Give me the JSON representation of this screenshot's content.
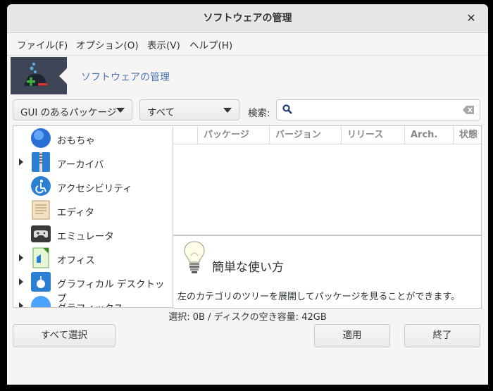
{
  "window": {
    "title": "ソフトウェアの管理",
    "close_glyph": "✕"
  },
  "menu": [
    "ファイル(F)",
    "オプション(O)",
    "表示(V)",
    "ヘルプ(H)"
  ],
  "banner": {
    "title": "ソフトウェアの管理"
  },
  "filters": {
    "type_selected": "GUI のあるパッケージ",
    "scope_selected": "すべて",
    "search_label": "検索:",
    "search_value": ""
  },
  "categories": [
    {
      "label": "おもちゃ",
      "expandable": false,
      "icon": "toys-icon"
    },
    {
      "label": "アーカイバ",
      "expandable": true,
      "icon": "archiver-icon"
    },
    {
      "label": "アクセシビリティ",
      "expandable": false,
      "icon": "accessibility-icon"
    },
    {
      "label": "エディタ",
      "expandable": false,
      "icon": "editor-icon"
    },
    {
      "label": "エミュレータ",
      "expandable": false,
      "icon": "emulator-icon"
    },
    {
      "label": "オフィス",
      "expandable": true,
      "icon": "office-icon"
    },
    {
      "label": "グラフィカル デスクトップ",
      "expandable": true,
      "icon": "desktop-icon"
    },
    {
      "label": "グラフィックス",
      "expandable": true,
      "icon": "graphics-icon"
    }
  ],
  "columns": [
    "パッケージ",
    "バージョン",
    "リリース",
    "Arch.",
    "状態"
  ],
  "description": {
    "title": "簡単な使い方",
    "text": "左のカテゴリのツリーを展開してパッケージを見ることができます。"
  },
  "status": "選択: 0B / ディスクの空き容量: 42GB",
  "buttons": {
    "select_all": "すべて選択",
    "apply": "適用",
    "quit": "終了"
  },
  "colors": {
    "link": "#4a76b8",
    "banner_bg": "#3d4556"
  }
}
